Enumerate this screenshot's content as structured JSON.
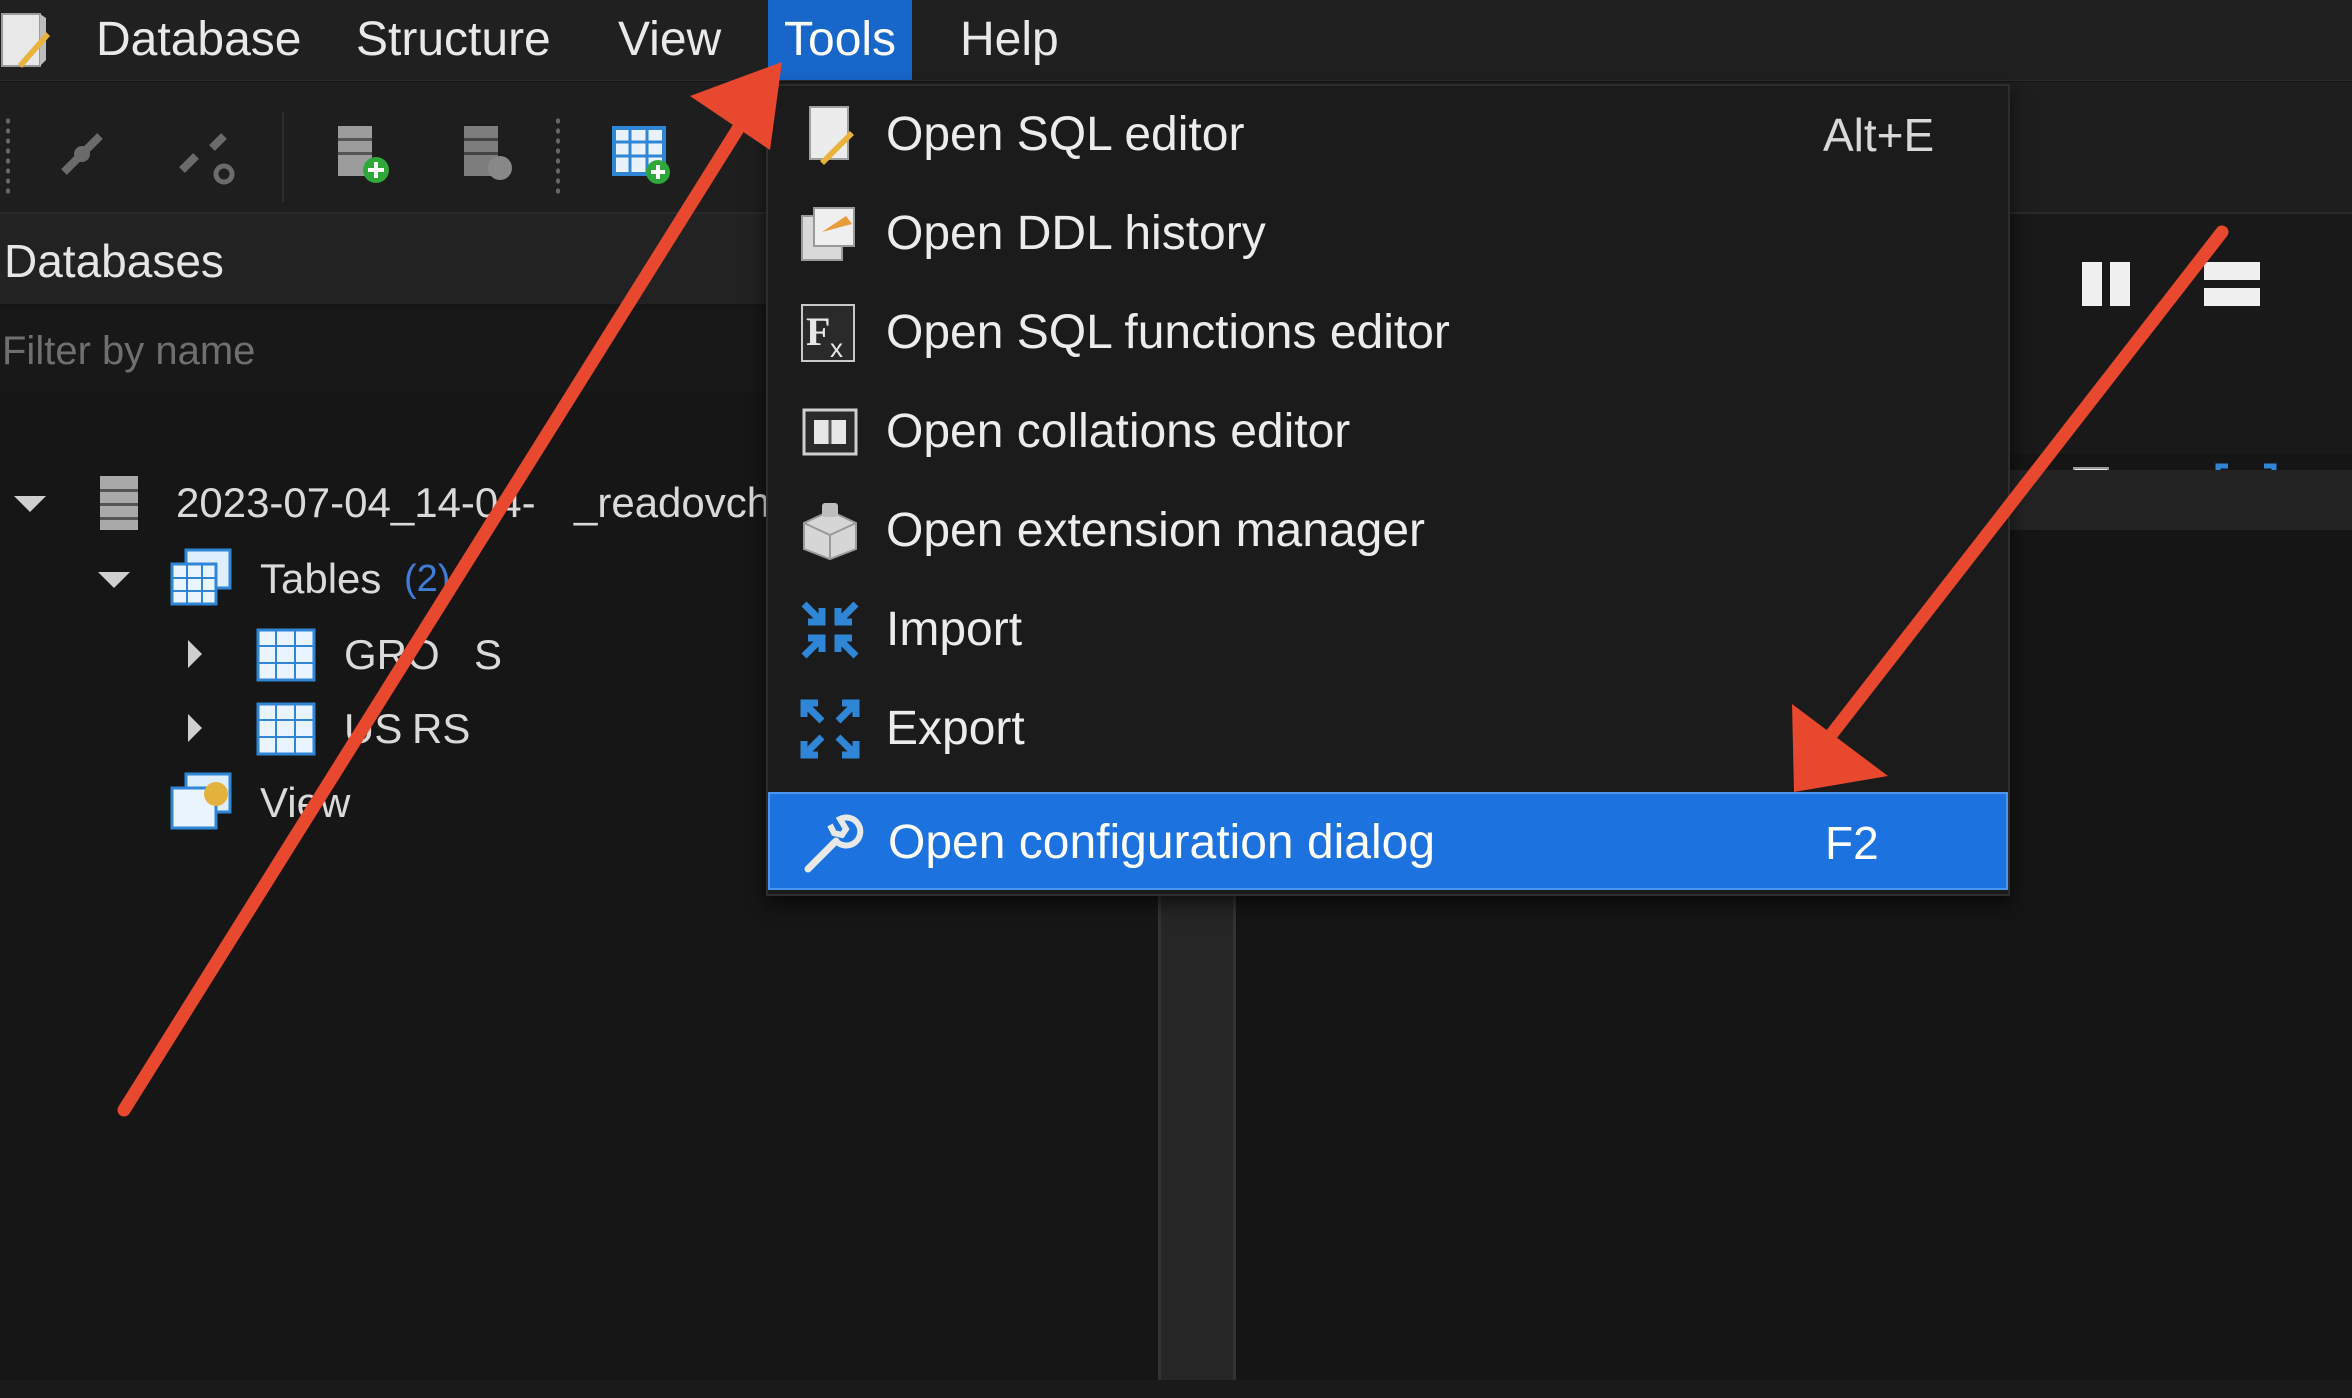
{
  "menubar": {
    "items": [
      {
        "label": "Database"
      },
      {
        "label": "Structure"
      },
      {
        "label": "View"
      },
      {
        "label": "Tools",
        "active": true
      },
      {
        "label": "Help"
      }
    ]
  },
  "databases_panel": {
    "title": "Databases",
    "filter_placeholder": "Filter by name",
    "tree": {
      "database": "2023-07-04_14-04-",
      "database_suffix": "_readovch",
      "tables_label": "Tables",
      "tables_count": "(2)",
      "tables": [
        "GRO",
        "US"
      ],
      "tables_tail": [
        "S",
        "RS"
      ],
      "views_label": "View"
    }
  },
  "tools_menu": {
    "items": [
      {
        "label": "Open SQL editor",
        "shortcut": "Alt+E",
        "icon": "sql-editor-icon"
      },
      {
        "label": "Open DDL history",
        "shortcut": "",
        "icon": "ddl-history-icon"
      },
      {
        "label": "Open SQL functions editor",
        "shortcut": "",
        "icon": "sql-functions-icon"
      },
      {
        "label": "Open collations editor",
        "shortcut": "",
        "icon": "collations-icon"
      },
      {
        "label": "Open extension manager",
        "shortcut": "",
        "icon": "extension-manager-icon"
      },
      {
        "label": "Import",
        "shortcut": "",
        "icon": "import-icon"
      },
      {
        "label": "Export",
        "shortcut": "",
        "icon": "export-icon"
      },
      {
        "label": "Open configuration dialog",
        "shortcut": "F2",
        "icon": "wrench-icon",
        "highlighted": true
      }
    ]
  },
  "colors": {
    "accent": "#1c73e0",
    "annotation_arrow": "#e8492e",
    "background": "#161616"
  }
}
